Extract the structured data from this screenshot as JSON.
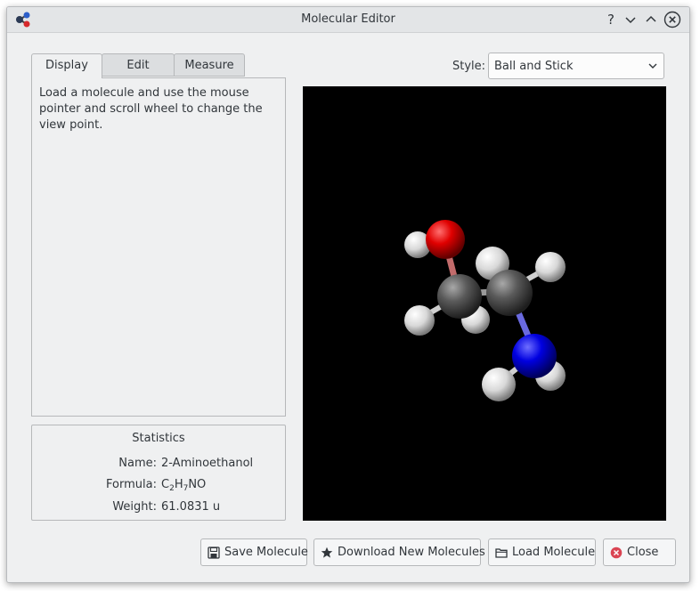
{
  "window": {
    "title": "Molecular Editor"
  },
  "titlebar_buttons": {
    "help": "?",
    "minimize_icon": "chevron-down-icon",
    "maximize_icon": "chevron-up-icon",
    "close_icon": "close-icon"
  },
  "tabs": [
    {
      "label": "Display",
      "active": true
    },
    {
      "label": "Edit",
      "active": false
    },
    {
      "label": "Measure",
      "active": false
    }
  ],
  "display_tab": {
    "text": "Load a molecule and use the mouse pointer and scroll wheel to change the view point."
  },
  "statistics": {
    "title": "Statistics",
    "name_label": "Name:",
    "name_value": "2-Aminoethanol",
    "formula_label": "Formula:",
    "formula": {
      "c": "C",
      "c_n": "2",
      "h": "H",
      "h_n": "7",
      "rest": "NO"
    },
    "weight_label": "Weight:",
    "weight_value": "61.0831 u"
  },
  "style": {
    "label": "Style:",
    "selected": "Ball and Stick"
  },
  "viewer": {
    "background": "#000000",
    "atom_colors": {
      "carbon": "#5a5a5a",
      "hydrogen": "#e6e6e6",
      "oxygen": "#e00000",
      "nitrogen": "#0000e0"
    }
  },
  "buttons": {
    "save": "Save Molecule",
    "download": "Download New Molecules",
    "load": "Load Molecule",
    "close": "Close"
  },
  "colors": {
    "accent": "#3daee9",
    "close_red": "#da4453"
  }
}
